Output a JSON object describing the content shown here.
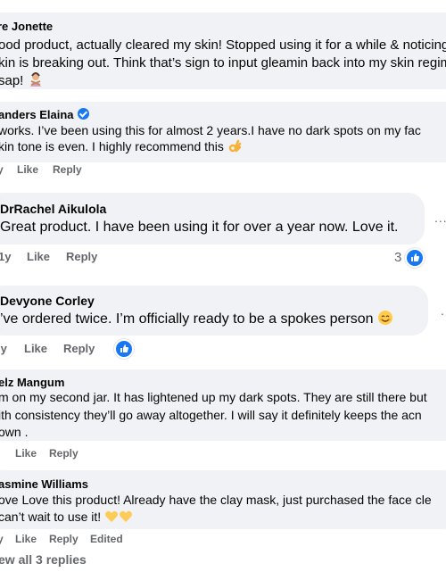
{
  "comments": [
    {
      "author": "re Jonette",
      "lines": [
        "ood product, actually cleared my skin! Stopped using it for a while & noticing",
        "kin is breaking out. Think that’s sign to input gleamin back into my skin regim",
        "sap!"
      ],
      "emoji": "woman-gesturing-no"
    },
    {
      "author": "anders Elaina",
      "verified": true,
      "lines": [
        "works. I’ve been using this for almost 2 years.I have no dark spots on my fac",
        "kin tone is even. I highly recommend this"
      ],
      "emoji": "ok-hand",
      "actions": {
        "age": "y",
        "like": "Like",
        "reply": "Reply"
      }
    },
    {
      "author": "DrRachel Aikulola",
      "lines": [
        "Great product. I have been using it for over a year now. Love it."
      ],
      "actions": {
        "age": "1y",
        "like": "Like",
        "reply": "Reply"
      },
      "reaction_count": "3",
      "more": "..."
    },
    {
      "author": "Devyone Corley",
      "lines": [
        "’ve ordered twice. I’m officially ready to be a spokes person"
      ],
      "emoji": "smiling-face",
      "actions": {
        "age": "ly",
        "like": "Like",
        "reply": "Reply"
      },
      "more": "."
    },
    {
      "author": "elz Mangum",
      "lines": [
        "m on my second jar. It has lightened up my dark spots. They are still there but",
        "ith consistency they’ll go away altogether. I will say it definitely keeps the acn",
        "own ."
      ],
      "actions": {
        "age": "",
        "like": "Like",
        "reply": "Reply"
      }
    },
    {
      "author": "asmine Williams",
      "lines": [
        "ove Love this product! Already have the clay mask, just purchased the face cle",
        "can’t wait to use it!"
      ],
      "emoji": "yellow-hearts",
      "actions": {
        "age": "y",
        "like": "Like",
        "reply": "Reply",
        "edited": "Edited"
      }
    }
  ],
  "view_replies": "ew all 3 replies",
  "colors": {
    "bubble": "#f0f2f5",
    "meta_text": "#65676b",
    "brand_blue": "#1877f2"
  }
}
